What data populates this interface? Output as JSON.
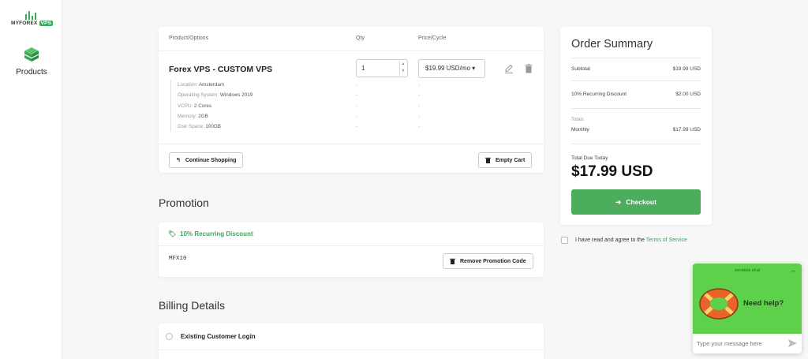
{
  "brand": {
    "name": "MYFOREX",
    "badge": "VPS"
  },
  "sidebar": {
    "products_label": "Products"
  },
  "cart": {
    "headers": {
      "product": "Product/Options",
      "qty": "Qty",
      "price": "Price/Cycle"
    },
    "product_name": "Forex VPS - CUSTOM VPS",
    "options": [
      {
        "label": "Location:",
        "value": "Amsterdam"
      },
      {
        "label": "Operating System:",
        "value": "Windows 2019"
      },
      {
        "label": "VCPU:",
        "value": "2 Cores"
      },
      {
        "label": "Memory:",
        "value": "2GB"
      },
      {
        "label": "Disk Space:",
        "value": "100GB"
      }
    ],
    "dash": "-",
    "qty_value": "1",
    "price_cycle": "$19.99 USD/mo",
    "continue_label": "Continue Shopping",
    "empty_label": "Empty Cart"
  },
  "promotion": {
    "title": "Promotion",
    "discount_name": "10% Recurring Discount",
    "code": "MFX10",
    "remove_label": "Remove Promotion Code"
  },
  "billing": {
    "title": "Billing Details",
    "existing_login": "Existing Customer Login"
  },
  "summary": {
    "title": "Order Summary",
    "subtotal_label": "Subtotal",
    "subtotal_value": "$19.99 USD",
    "discount_label": "10% Recurring Discount",
    "discount_value": "$2.00 USD",
    "totals_label": "Totals",
    "monthly_label": "Monthly",
    "monthly_value": "$17.99 USD",
    "due_label": "Total Due Today",
    "due_value": "$17.99 USD",
    "checkout_label": "Checkout"
  },
  "tos": {
    "text": "I have read and agree to the",
    "link": "Terms of Service"
  },
  "chat": {
    "brand": "zendesk chat",
    "minimize": "–",
    "help": "Need help?",
    "placeholder": "Type your message here"
  },
  "colors": {
    "accent": "#3aa857",
    "checkout": "#4cae5c",
    "chat_bg": "#5ed14a"
  }
}
